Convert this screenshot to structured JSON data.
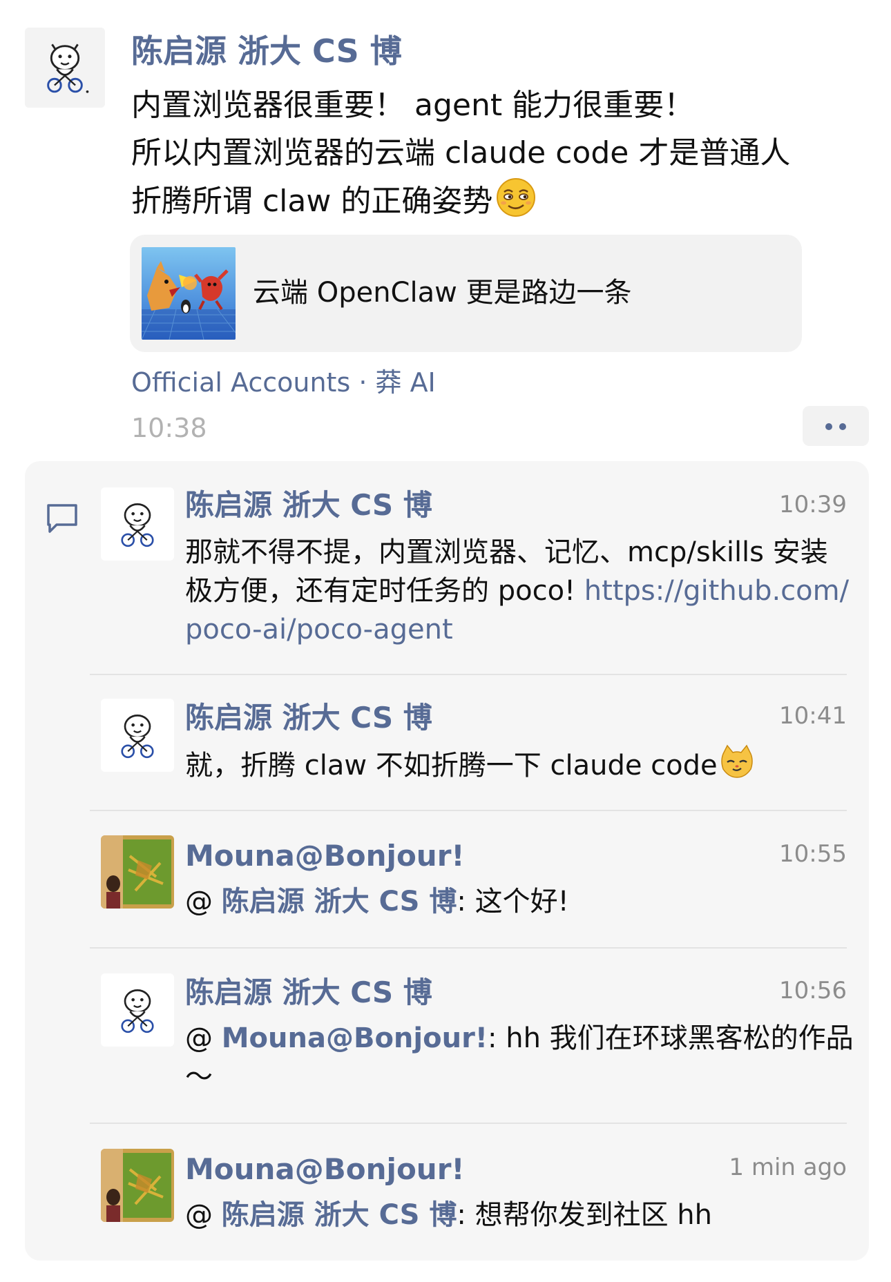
{
  "post": {
    "author": "陈启源 浙大 CS 博",
    "text_lines": [
      "内置浏览器很重要！ agent 能力很重要！",
      "所以内置浏览器的云端 claude code 才是普通人",
      "折腾所谓 claw 的正确姿势"
    ],
    "text_emoji": "smirk-emoji",
    "share": {
      "title": "云端 OpenClaw 更是路边一条"
    },
    "source": "Official Accounts · 莽 AI",
    "time": "10:38",
    "more_icon": "two-dots-icon"
  },
  "comments": [
    {
      "author": "陈启源 浙大 CS 博",
      "time": "10:39",
      "text_before": "那就不得不提，内置浏览器、记忆、mcp/skills 安装极方便，还有定时任务的 poco! ",
      "link": "https://github.com/poco-ai/poco-agent"
    },
    {
      "author": "陈启源 浙大 CS 博",
      "time": "10:41",
      "text": "就，折腾 claw 不如折腾一下 claude code",
      "emoji": "cat-emoji"
    },
    {
      "author": "Mouna@Bonjour!",
      "time": "10:55",
      "at": "@ ",
      "mention": "陈启源 浙大 CS 博",
      "text": ": 这个好!"
    },
    {
      "author": "陈启源 浙大 CS 博",
      "time": "10:56",
      "at": "@ ",
      "mention": "Mouna@Bonjour!",
      "text": ": hh 我们在环球黑客松的作品～"
    },
    {
      "author": "Mouna@Bonjour!",
      "time": "1 min ago",
      "at": "@ ",
      "mention": "陈启源 浙大 CS 博",
      "text": ": 想帮你发到社区 hh"
    }
  ],
  "colors": {
    "link_blue": "#576b95",
    "time_gray": "#b2b2b2",
    "panel_bg": "#f6f6f6"
  }
}
